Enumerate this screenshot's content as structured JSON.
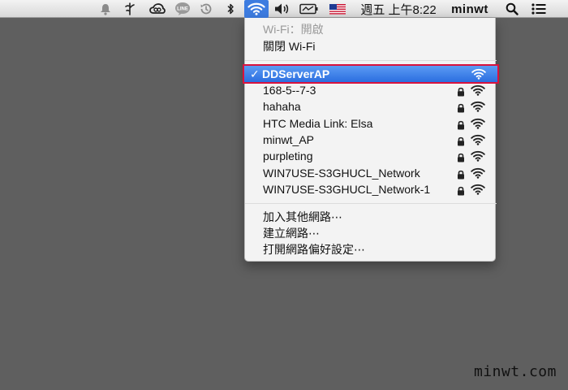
{
  "menubar": {
    "clock": "週五 上午8:22",
    "user": "minwt",
    "flag_colors": {
      "red": "#c8102e",
      "blue": "#1f3a93",
      "white": "#ffffff"
    }
  },
  "menu": {
    "wifi_status": "Wi-Fi：開啟",
    "toggle_wifi": "關閉 Wi-Fi",
    "networks": [
      {
        "name": "DDServerAP",
        "selected": true,
        "locked": false
      },
      {
        "name": "168-5--7-3",
        "selected": false,
        "locked": true
      },
      {
        "name": "hahaha",
        "selected": false,
        "locked": true
      },
      {
        "name": "HTC Media Link: Elsa",
        "selected": false,
        "locked": true
      },
      {
        "name": "minwt_AP",
        "selected": false,
        "locked": true
      },
      {
        "name": "purpleting",
        "selected": false,
        "locked": true
      },
      {
        "name": "WIN7USE-S3GHUCL_Network",
        "selected": false,
        "locked": true
      },
      {
        "name": "WIN7USE-S3GHUCL_Network-1",
        "selected": false,
        "locked": true
      }
    ],
    "join_other": "加入其他網路⋯",
    "create_network": "建立網路⋯",
    "open_prefs": "打開網路偏好設定⋯",
    "highlight_color": "#d9123d"
  },
  "watermark": "minwt.com"
}
